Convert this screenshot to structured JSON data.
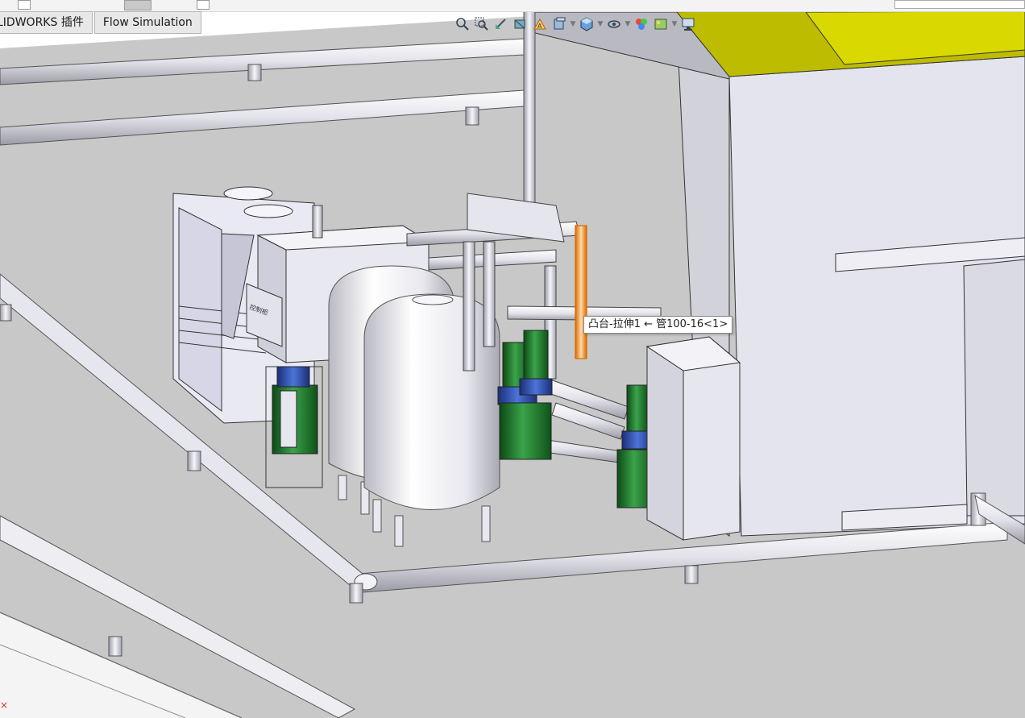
{
  "command_tabs": [
    "LIDWORKS 插件",
    "Flow Simulation"
  ],
  "tooltip": "凸台-拉伸1 ← 管100-16<1>",
  "panel_label": "控制柜",
  "heads_up_toolbar": [
    "zoom-to-fit-icon",
    "zoom-to-area-icon",
    "previous-view-icon",
    "section-view-icon",
    "dynamic-annotation-icon",
    "view-orientation-icon",
    "display-style-icon",
    "hide-show-items-icon",
    "edit-appearance-icon",
    "apply-scene-icon",
    "view-settings-icon"
  ],
  "colors": {
    "floor": "#c9c9c9",
    "floor_light": "#dcdcdc",
    "model_white": "#e6e6ef",
    "pump_green": "#1f7a2c",
    "pump_blue": "#2a4fb0",
    "roof_yellow": "#c9c800",
    "highlight_orange": "#ff8c00"
  },
  "error_mark": "×"
}
